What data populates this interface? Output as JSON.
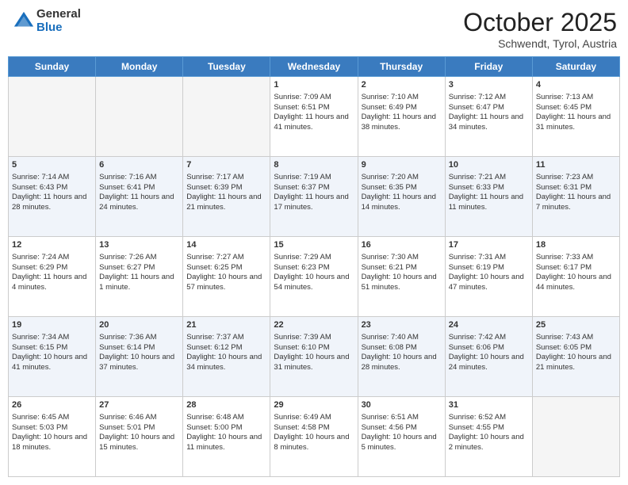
{
  "header": {
    "logo_general": "General",
    "logo_blue": "Blue",
    "month_title": "October 2025",
    "location": "Schwendt, Tyrol, Austria"
  },
  "days_of_week": [
    "Sunday",
    "Monday",
    "Tuesday",
    "Wednesday",
    "Thursday",
    "Friday",
    "Saturday"
  ],
  "weeks": [
    [
      {
        "day": "",
        "content": ""
      },
      {
        "day": "",
        "content": ""
      },
      {
        "day": "",
        "content": ""
      },
      {
        "day": "1",
        "content": "Sunrise: 7:09 AM\nSunset: 6:51 PM\nDaylight: 11 hours and 41 minutes."
      },
      {
        "day": "2",
        "content": "Sunrise: 7:10 AM\nSunset: 6:49 PM\nDaylight: 11 hours and 38 minutes."
      },
      {
        "day": "3",
        "content": "Sunrise: 7:12 AM\nSunset: 6:47 PM\nDaylight: 11 hours and 34 minutes."
      },
      {
        "day": "4",
        "content": "Sunrise: 7:13 AM\nSunset: 6:45 PM\nDaylight: 11 hours and 31 minutes."
      }
    ],
    [
      {
        "day": "5",
        "content": "Sunrise: 7:14 AM\nSunset: 6:43 PM\nDaylight: 11 hours and 28 minutes."
      },
      {
        "day": "6",
        "content": "Sunrise: 7:16 AM\nSunset: 6:41 PM\nDaylight: 11 hours and 24 minutes."
      },
      {
        "day": "7",
        "content": "Sunrise: 7:17 AM\nSunset: 6:39 PM\nDaylight: 11 hours and 21 minutes."
      },
      {
        "day": "8",
        "content": "Sunrise: 7:19 AM\nSunset: 6:37 PM\nDaylight: 11 hours and 17 minutes."
      },
      {
        "day": "9",
        "content": "Sunrise: 7:20 AM\nSunset: 6:35 PM\nDaylight: 11 hours and 14 minutes."
      },
      {
        "day": "10",
        "content": "Sunrise: 7:21 AM\nSunset: 6:33 PM\nDaylight: 11 hours and 11 minutes."
      },
      {
        "day": "11",
        "content": "Sunrise: 7:23 AM\nSunset: 6:31 PM\nDaylight: 11 hours and 7 minutes."
      }
    ],
    [
      {
        "day": "12",
        "content": "Sunrise: 7:24 AM\nSunset: 6:29 PM\nDaylight: 11 hours and 4 minutes."
      },
      {
        "day": "13",
        "content": "Sunrise: 7:26 AM\nSunset: 6:27 PM\nDaylight: 11 hours and 1 minute."
      },
      {
        "day": "14",
        "content": "Sunrise: 7:27 AM\nSunset: 6:25 PM\nDaylight: 10 hours and 57 minutes."
      },
      {
        "day": "15",
        "content": "Sunrise: 7:29 AM\nSunset: 6:23 PM\nDaylight: 10 hours and 54 minutes."
      },
      {
        "day": "16",
        "content": "Sunrise: 7:30 AM\nSunset: 6:21 PM\nDaylight: 10 hours and 51 minutes."
      },
      {
        "day": "17",
        "content": "Sunrise: 7:31 AM\nSunset: 6:19 PM\nDaylight: 10 hours and 47 minutes."
      },
      {
        "day": "18",
        "content": "Sunrise: 7:33 AM\nSunset: 6:17 PM\nDaylight: 10 hours and 44 minutes."
      }
    ],
    [
      {
        "day": "19",
        "content": "Sunrise: 7:34 AM\nSunset: 6:15 PM\nDaylight: 10 hours and 41 minutes."
      },
      {
        "day": "20",
        "content": "Sunrise: 7:36 AM\nSunset: 6:14 PM\nDaylight: 10 hours and 37 minutes."
      },
      {
        "day": "21",
        "content": "Sunrise: 7:37 AM\nSunset: 6:12 PM\nDaylight: 10 hours and 34 minutes."
      },
      {
        "day": "22",
        "content": "Sunrise: 7:39 AM\nSunset: 6:10 PM\nDaylight: 10 hours and 31 minutes."
      },
      {
        "day": "23",
        "content": "Sunrise: 7:40 AM\nSunset: 6:08 PM\nDaylight: 10 hours and 28 minutes."
      },
      {
        "day": "24",
        "content": "Sunrise: 7:42 AM\nSunset: 6:06 PM\nDaylight: 10 hours and 24 minutes."
      },
      {
        "day": "25",
        "content": "Sunrise: 7:43 AM\nSunset: 6:05 PM\nDaylight: 10 hours and 21 minutes."
      }
    ],
    [
      {
        "day": "26",
        "content": "Sunrise: 6:45 AM\nSunset: 5:03 PM\nDaylight: 10 hours and 18 minutes."
      },
      {
        "day": "27",
        "content": "Sunrise: 6:46 AM\nSunset: 5:01 PM\nDaylight: 10 hours and 15 minutes."
      },
      {
        "day": "28",
        "content": "Sunrise: 6:48 AM\nSunset: 5:00 PM\nDaylight: 10 hours and 11 minutes."
      },
      {
        "day": "29",
        "content": "Sunrise: 6:49 AM\nSunset: 4:58 PM\nDaylight: 10 hours and 8 minutes."
      },
      {
        "day": "30",
        "content": "Sunrise: 6:51 AM\nSunset: 4:56 PM\nDaylight: 10 hours and 5 minutes."
      },
      {
        "day": "31",
        "content": "Sunrise: 6:52 AM\nSunset: 4:55 PM\nDaylight: 10 hours and 2 minutes."
      },
      {
        "day": "",
        "content": ""
      }
    ]
  ]
}
